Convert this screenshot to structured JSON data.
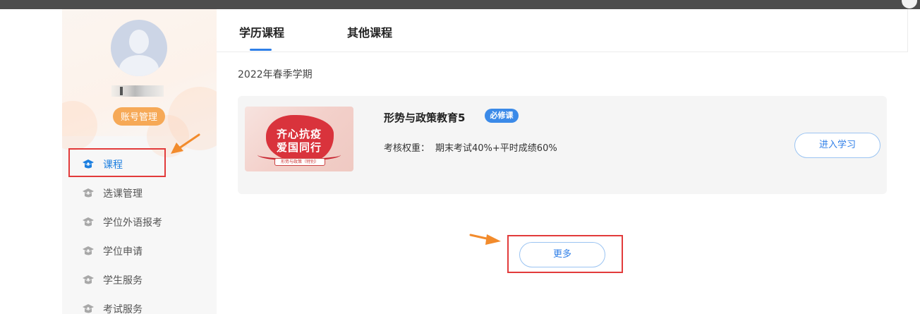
{
  "sidebar": {
    "account_button": "账号管理",
    "nav": [
      {
        "label": "课程",
        "active": true
      },
      {
        "label": "选课管理",
        "active": false
      },
      {
        "label": "学位外语报考",
        "active": false
      },
      {
        "label": "学位申请",
        "active": false
      },
      {
        "label": "学生服务",
        "active": false
      },
      {
        "label": "考试服务",
        "active": false
      }
    ]
  },
  "tabs": [
    {
      "label": "学历课程",
      "active": true
    },
    {
      "label": "其他课程",
      "active": false
    }
  ],
  "semester": "2022年春季学期",
  "course": {
    "thumbnail_text": {
      "line1": "齐心抗疫",
      "line2": "爱国同行",
      "sub": "形势与政策（特别）"
    },
    "title": "形势与政策教育5",
    "badge": "必修课",
    "weight_label": "考核权重：",
    "weight_value": "期末考试40%+平时成绩60%",
    "enter_button": "进入学习"
  },
  "more_button": "更多",
  "colors": {
    "accent": "#2f7fe8",
    "badge": "#3b8ae8",
    "account_button": "#f6a957",
    "highlight_box": "#e23b3b",
    "arrow": "#f28b2c"
  }
}
